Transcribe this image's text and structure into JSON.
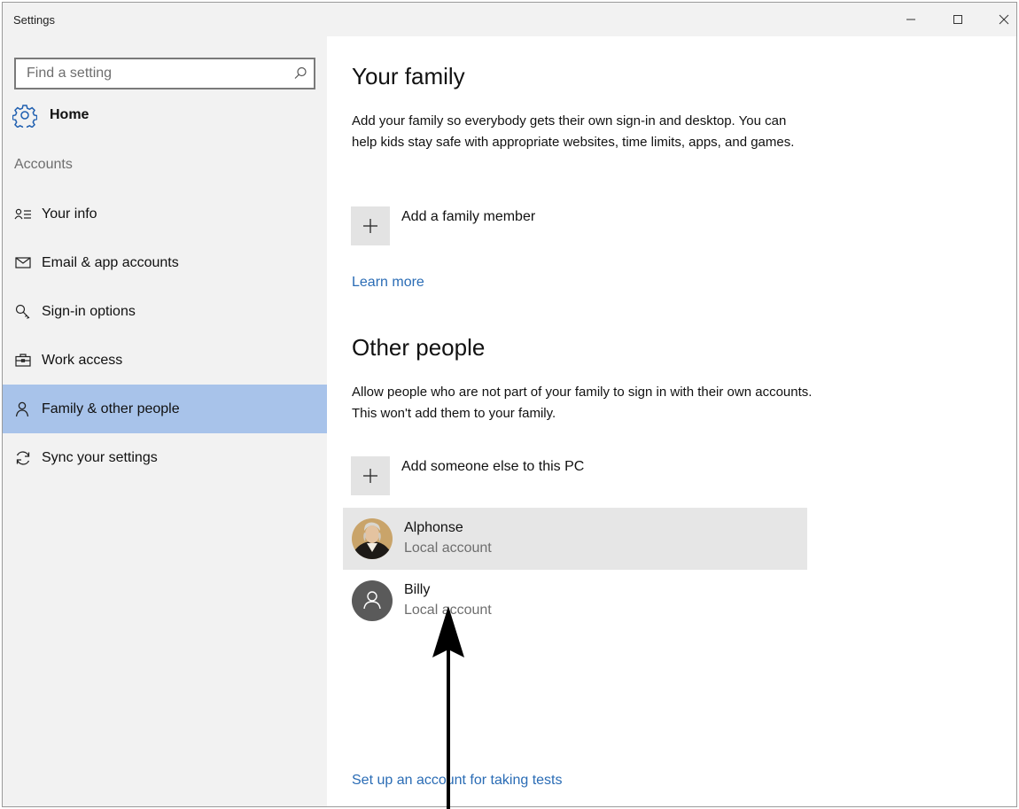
{
  "window": {
    "title": "Settings"
  },
  "search": {
    "placeholder": "Find a setting"
  },
  "home": {
    "label": "Home"
  },
  "sidebar": {
    "section_label": "Accounts",
    "items": [
      {
        "label": "Your info",
        "icon": "your-info-icon"
      },
      {
        "label": "Email & app accounts",
        "icon": "mail-icon"
      },
      {
        "label": "Sign-in options",
        "icon": "key-icon"
      },
      {
        "label": "Work access",
        "icon": "briefcase-icon"
      },
      {
        "label": "Family & other people",
        "icon": "person-icon",
        "selected": true
      },
      {
        "label": "Sync your settings",
        "icon": "sync-icon"
      }
    ]
  },
  "main": {
    "family": {
      "heading": "Your family",
      "description": "Add your family so everybody gets their own sign-in and desktop. You can help kids stay safe with appropriate websites, time limits, apps, and games.",
      "add_label": "Add a family member",
      "learn_more": "Learn more"
    },
    "other": {
      "heading": "Other people",
      "description": "Allow people who are not part of your family to sign in with their own accounts. This won't add them to your family.",
      "add_label": "Add someone else to this PC",
      "people": [
        {
          "name": "Alphonse",
          "account": "Local account"
        },
        {
          "name": "Billy",
          "account": "Local account"
        }
      ]
    },
    "test_link": "Set up an account for taking tests"
  },
  "colors": {
    "selected_nav": "#a8c3ea",
    "link": "#2a6cb5",
    "sidebar_bg": "#f2f2f2",
    "hover_row": "#e6e6e6"
  }
}
